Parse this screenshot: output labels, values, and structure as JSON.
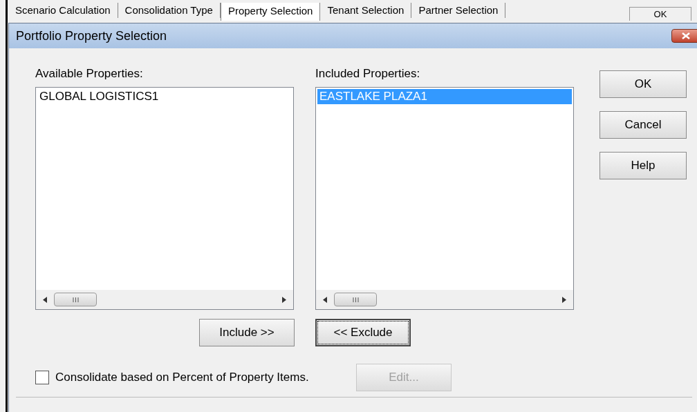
{
  "background_tabs": [
    {
      "label": "Scenario Calculation",
      "selected": false
    },
    {
      "label": "Consolidation Type",
      "selected": false
    },
    {
      "label": "Property Selection",
      "selected": true
    },
    {
      "label": "Tenant Selection",
      "selected": false
    },
    {
      "label": "Partner Selection",
      "selected": false
    }
  ],
  "background_button": "OK",
  "dialog": {
    "title": "Portfolio Property Selection",
    "available": {
      "label": "Available Properties:",
      "items": [
        {
          "text": "GLOBAL LOGISTICS1",
          "selected": false
        }
      ]
    },
    "included": {
      "label": "Included Properties:",
      "items": [
        {
          "text": "EASTLAKE PLAZA1",
          "selected": true
        }
      ]
    },
    "side_buttons": [
      {
        "label": "OK",
        "focused": false,
        "disabled": false
      },
      {
        "label": "Cancel",
        "focused": false,
        "disabled": false
      },
      {
        "label": "Help",
        "focused": false,
        "disabled": false
      }
    ],
    "move_buttons": [
      {
        "label": "Include >>",
        "focused": false,
        "disabled": false
      },
      {
        "label": "<< Exclude",
        "focused": true,
        "disabled": false
      }
    ],
    "checkbox": {
      "label": "Consolidate based on Percent of Property Items.",
      "checked": false
    },
    "edit_button": {
      "label": "Edit...",
      "focused": false,
      "disabled": true
    }
  }
}
